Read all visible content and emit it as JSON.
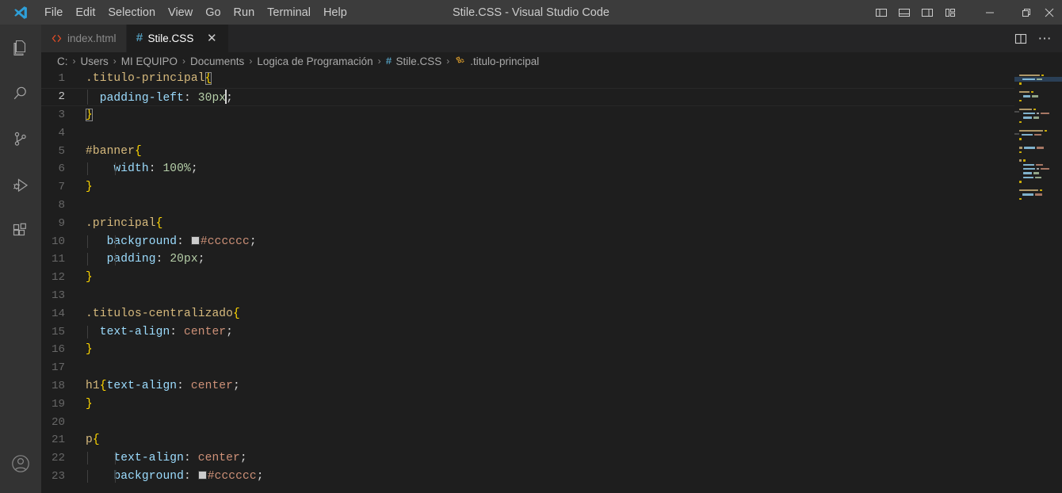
{
  "window": {
    "title": "Stile.CSS - Visual Studio Code",
    "logo_icon": "vscode-logo-icon"
  },
  "menubar": {
    "items": [
      {
        "label": "File"
      },
      {
        "label": "Edit"
      },
      {
        "label": "Selection"
      },
      {
        "label": "View"
      },
      {
        "label": "Go"
      },
      {
        "label": "Run"
      },
      {
        "label": "Terminal"
      },
      {
        "label": "Help"
      }
    ]
  },
  "titlebar_actions": {
    "layout_icons": [
      {
        "name": "toggle-primary-sidebar-icon",
        "title": "Toggle Primary Side Bar"
      },
      {
        "name": "toggle-panel-icon",
        "title": "Toggle Panel"
      },
      {
        "name": "toggle-secondary-sidebar-icon",
        "title": "Toggle Secondary Side Bar"
      },
      {
        "name": "customize-layout-icon",
        "title": "Customize Layout"
      }
    ],
    "window_controls": [
      {
        "name": "minimize-button",
        "glyph": "—"
      },
      {
        "name": "maximize-button",
        "glyph": "❐"
      },
      {
        "name": "close-button",
        "glyph": "✕"
      }
    ]
  },
  "activitybar": {
    "items": [
      {
        "name": "explorer",
        "icon": "files-icon",
        "label": "Explorer"
      },
      {
        "name": "search",
        "icon": "search-icon",
        "label": "Search"
      },
      {
        "name": "source-control",
        "icon": "source-control-icon",
        "label": "Source Control"
      },
      {
        "name": "run-debug",
        "icon": "run-and-debug-icon",
        "label": "Run and Debug"
      },
      {
        "name": "extensions",
        "icon": "extensions-icon",
        "label": "Extensions"
      }
    ],
    "bottom": [
      {
        "name": "accounts",
        "icon": "account-icon",
        "label": "Accounts"
      }
    ]
  },
  "tabs": [
    {
      "label": "index.html",
      "icon": "html-file-icon",
      "active": false,
      "icon_color": "#e44d26"
    },
    {
      "label": "Stile.CSS",
      "icon": "css-file-icon",
      "active": true,
      "icon_color": "#519aba",
      "close_glyph": "✕"
    }
  ],
  "editor_actions": [
    {
      "name": "split-editor-right-icon",
      "label": "Split Editor Right"
    },
    {
      "name": "more-actions-icon",
      "label": "More Actions...",
      "glyph": "⋯"
    }
  ],
  "breadcrumbs": {
    "separator": "›",
    "segments": [
      {
        "label": "C:"
      },
      {
        "label": "Users"
      },
      {
        "label": "MI EQUIPO"
      },
      {
        "label": "Documents"
      },
      {
        "label": "Logica de Programación"
      },
      {
        "label": "Stile.CSS",
        "icon": "css-file-icon"
      },
      {
        "label": ".titulo-principal",
        "icon": "css-symbol-icon"
      }
    ]
  },
  "editor": {
    "language": "CSS",
    "active_line": 2,
    "cursor": {
      "line": 2,
      "column": 22
    },
    "lines": [
      {
        "n": 1,
        "text": ".titulo-principal{"
      },
      {
        "n": 2,
        "text": "    padding-left: 30px;"
      },
      {
        "n": 3,
        "text": "}"
      },
      {
        "n": 4,
        "text": ""
      },
      {
        "n": 5,
        "text": "#banner{"
      },
      {
        "n": 6,
        "text": "    width: 100%;"
      },
      {
        "n": 7,
        "text": "}"
      },
      {
        "n": 8,
        "text": ""
      },
      {
        "n": 9,
        "text": ".principal{"
      },
      {
        "n": 10,
        "text": "    background: #cccccc;"
      },
      {
        "n": 11,
        "text": "    padding: 20px;"
      },
      {
        "n": 12,
        "text": "}"
      },
      {
        "n": 13,
        "text": ""
      },
      {
        "n": 14,
        "text": ".titulos-centralizado{"
      },
      {
        "n": 15,
        "text": "    text-align: center;"
      },
      {
        "n": 16,
        "text": "}"
      },
      {
        "n": 17,
        "text": ""
      },
      {
        "n": 18,
        "text": "h1{text-align: center;"
      },
      {
        "n": 19,
        "text": "}"
      },
      {
        "n": 20,
        "text": ""
      },
      {
        "n": 21,
        "text": "p{"
      },
      {
        "n": 22,
        "text": "    text-align: center;"
      },
      {
        "n": 23,
        "text": "    background: #cccccc;"
      }
    ],
    "colors": {
      "background": "#1e1e1e",
      "selector": "#d7ba7d",
      "brace": "#ffd700",
      "property": "#9cdcfe",
      "number": "#b5cea8",
      "string": "#ce9178",
      "punctuation": "#d4d4d4",
      "line_number": "#676767",
      "active_line_number": "#c6c6c6",
      "swatch_value": "#cccccc"
    }
  },
  "minimap": {
    "visible": true,
    "current_line_highlight": 2
  }
}
